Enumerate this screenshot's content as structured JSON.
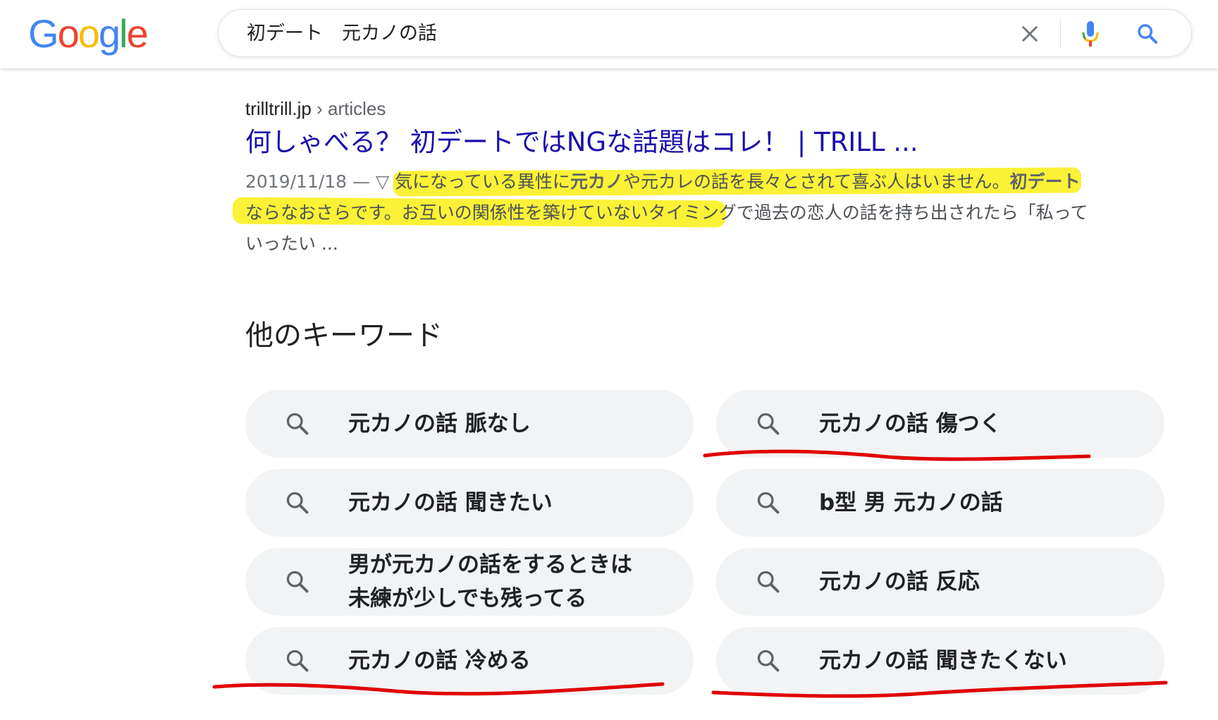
{
  "header": {
    "logo_letters": [
      {
        "char": "G",
        "color": "#4285F4"
      },
      {
        "char": "o",
        "color": "#EA4335"
      },
      {
        "char": "o",
        "color": "#FBBC05"
      },
      {
        "char": "g",
        "color": "#4285F4"
      },
      {
        "char": "l",
        "color": "#34A853"
      },
      {
        "char": "e",
        "color": "#EA4335"
      }
    ],
    "query": "初デート　元カノの話",
    "icons": {
      "clear": "close-icon",
      "voice": "mic-icon",
      "search": "search-icon"
    }
  },
  "result": {
    "domain": "trilltrill.jp",
    "separator": " › ",
    "path": "articles",
    "title": "何しゃべる？ 初デートではNGな話題はコレ！ | TRILL ...",
    "date": "2019/11/18",
    "dash": " — ▽ ",
    "snippet_p1": "気になっている異性に",
    "snippet_b1": "元カノ",
    "snippet_p2": "や元カレの話を長々とされて喜ぶ人はいません。",
    "snippet_b2": "初デート",
    "snippet_p3": "ならなおさらです。お互いの関係性を築けていないタイミングで過去の恋人の話を持ち出されたら「私っていったい ..."
  },
  "keywords": {
    "title": "他のキーワード",
    "items": [
      "元カノの話 脈なし",
      "元カノの話 傷つく",
      "元カノの話 聞きたい",
      "b型 男 元カノの話",
      "男が元カノの話をするときは\n未練が少しでも残ってる",
      "元カノの話 反応",
      "元カノの話 冷める",
      "元カノの話 聞きたくない"
    ]
  },
  "colors": {
    "highlight": "#fbf136",
    "underline": "#e00000",
    "link": "#1a0dab",
    "chip_bg": "#f1f3f4"
  }
}
